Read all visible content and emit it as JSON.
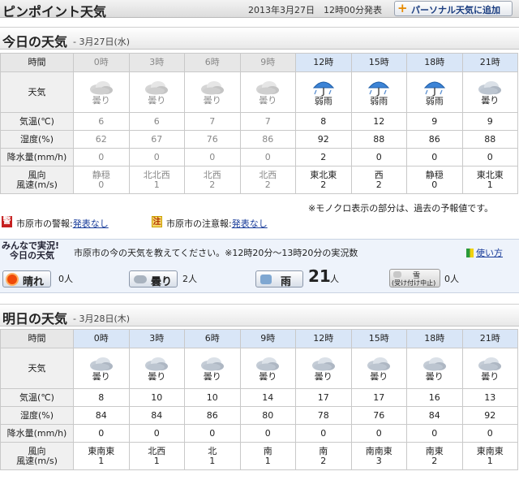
{
  "header": {
    "title": "ピンポイント天気",
    "issued": "2013年3月27日　12時00分発表",
    "personal_button": "パーソナル天気に追加"
  },
  "today": {
    "heading": "今日の天気",
    "date": "- 3月27日(水)",
    "row_labels": {
      "time": "時間",
      "weather": "天気",
      "temp": "気温(℃)",
      "humidity": "湿度(%)",
      "precip": "降水量(mm/h)",
      "wind_dir": "風向",
      "wind_speed": "風速(m/s)"
    },
    "times": [
      "0時",
      "3時",
      "6時",
      "9時",
      "12時",
      "15時",
      "18時",
      "21時"
    ],
    "weather": [
      "曇り",
      "曇り",
      "曇り",
      "曇り",
      "弱雨",
      "弱雨",
      "弱雨",
      "曇り"
    ],
    "icons": [
      "cloud-icon",
      "cloud-icon",
      "cloud-icon",
      "cloud-icon",
      "rain-umbrella-icon",
      "rain-umbrella-icon",
      "rain-umbrella-icon",
      "cloud-icon"
    ],
    "temp": [
      "6",
      "6",
      "7",
      "7",
      "8",
      "12",
      "9",
      "9"
    ],
    "humidity": [
      "62",
      "67",
      "76",
      "86",
      "92",
      "88",
      "86",
      "88"
    ],
    "precip": [
      "0",
      "0",
      "0",
      "0",
      "2",
      "0",
      "0",
      "0"
    ],
    "wind_dir": [
      "静穏",
      "北北西",
      "北西",
      "北西",
      "東北東",
      "西",
      "静穏",
      "東北東"
    ],
    "wind_speed": [
      "0",
      "1",
      "2",
      "2",
      "2",
      "2",
      "0",
      "1"
    ],
    "past_columns": 4
  },
  "note": "※モノクロ表示の部分は、過去の予報値です。",
  "warnings": {
    "warning_badge": "警",
    "warning_label": "市原市の警報:",
    "warning_value": "発表なし",
    "advisory_badge": "注",
    "advisory_label": "市原市の注意報:",
    "advisory_value": "発表なし"
  },
  "minna": {
    "logo_line1": "みんなで実況!",
    "logo_line2": "今日の天気",
    "question": "市原市の今の天気を教えてください。※12時20分～13時20分の実況数",
    "usage_link": "使い方",
    "buttons": [
      {
        "label": "晴れ",
        "count": "0人"
      },
      {
        "label": "曇り",
        "count": "2人"
      },
      {
        "label": "雨",
        "count": "21",
        "unit": "人"
      },
      {
        "label": "雪",
        "sublabel": "(受け付け中止)",
        "count": "0人"
      }
    ]
  },
  "tomorrow": {
    "heading": "明日の天気",
    "date": "- 3月28日(木)",
    "times": [
      "0時",
      "3時",
      "6時",
      "9時",
      "12時",
      "15時",
      "18時",
      "21時"
    ],
    "weather": [
      "曇り",
      "曇り",
      "曇り",
      "曇り",
      "曇り",
      "曇り",
      "曇り",
      "曇り"
    ],
    "icons": [
      "cloud-icon",
      "cloud-icon",
      "cloud-icon",
      "cloud-icon",
      "cloud-icon",
      "cloud-icon",
      "cloud-icon",
      "cloud-icon"
    ],
    "temp": [
      "8",
      "10",
      "10",
      "14",
      "17",
      "17",
      "16",
      "13"
    ],
    "humidity": [
      "84",
      "84",
      "86",
      "80",
      "78",
      "76",
      "84",
      "92"
    ],
    "precip": [
      "0",
      "0",
      "0",
      "0",
      "0",
      "0",
      "0",
      "0"
    ],
    "wind_dir": [
      "東南東",
      "北西",
      "北",
      "南",
      "南",
      "南南東",
      "南東",
      "東南東"
    ],
    "wind_speed": [
      "1",
      "1",
      "1",
      "1",
      "2",
      "3",
      "2",
      "1"
    ]
  }
}
